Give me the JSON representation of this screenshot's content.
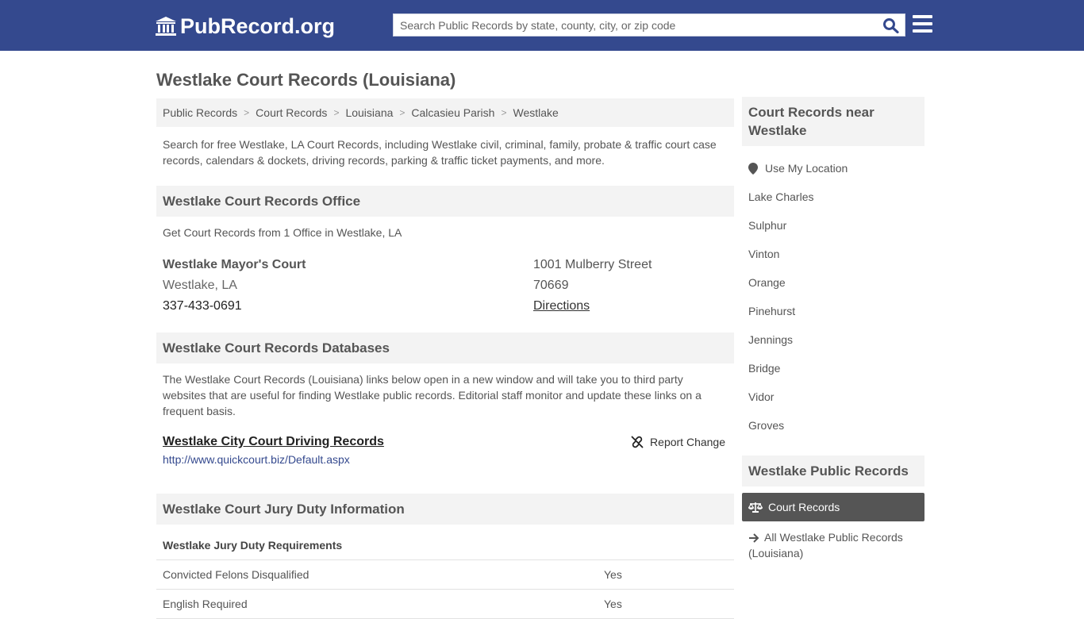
{
  "header": {
    "logo_text": "PubRecord.org",
    "search_placeholder": "Search Public Records by state, county, city, or zip code",
    "brand_color": "#34498e"
  },
  "page": {
    "title": "Westlake Court Records (Louisiana)"
  },
  "breadcrumb": [
    "Public Records",
    "Court Records",
    "Louisiana",
    "Calcasieu Parish",
    "Westlake"
  ],
  "intro": "Search for free Westlake, LA Court Records, including Westlake civil, criminal, family, probate & traffic court case records, calendars & dockets, driving records, parking & traffic ticket payments, and more.",
  "office_section": {
    "heading": "Westlake Court Records Office",
    "subtitle": "Get Court Records from 1 Office in Westlake, LA",
    "office": {
      "name": "Westlake Mayor's Court",
      "city": "Westlake, LA",
      "phone": "337-433-0691",
      "street": "1001 Mulberry Street",
      "zip": "70669",
      "directions": "Directions"
    }
  },
  "databases_section": {
    "heading": "Westlake Court Records Databases",
    "description": "The Westlake Court Records (Louisiana) links below open in a new window and will take you to third party websites that are useful for finding Westlake public records. Editorial staff monitor and update these links on a frequent basis.",
    "link": {
      "title": "Westlake City Court Driving Records",
      "url": "http://www.quickcourt.biz/Default.aspx",
      "report_label": "Report Change"
    }
  },
  "jury_section": {
    "heading": "Westlake Court Jury Duty Information",
    "subheading": "Westlake Jury Duty Requirements",
    "rows": [
      {
        "label": "Convicted Felons Disqualified",
        "value": "Yes"
      },
      {
        "label": "English Required",
        "value": "Yes"
      }
    ]
  },
  "sidebar": {
    "nearby_heading": "Court Records near Westlake",
    "use_location": "Use My Location",
    "nearby": [
      "Lake Charles",
      "Sulphur",
      "Vinton",
      "Orange",
      "Pinehurst",
      "Jennings",
      "Bridge",
      "Vidor",
      "Groves"
    ],
    "public_heading": "Westlake Public Records",
    "active_item": "Court Records",
    "all_records": "All Westlake Public Records (Louisiana)"
  }
}
